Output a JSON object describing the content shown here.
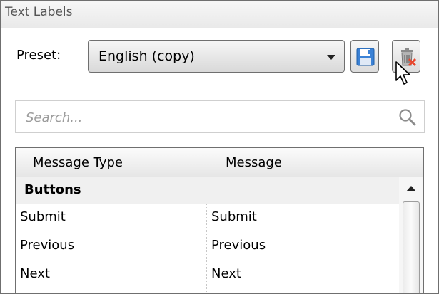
{
  "panel": {
    "title": "Text Labels"
  },
  "preset": {
    "label": "Preset:",
    "selected": "English (copy)"
  },
  "search": {
    "placeholder": "Search..."
  },
  "table": {
    "columns": [
      "Message Type",
      "Message"
    ],
    "group": "Buttons",
    "rows": [
      {
        "type": "Submit",
        "message": "Submit"
      },
      {
        "type": "Previous",
        "message": "Previous"
      },
      {
        "type": "Next",
        "message": "Next"
      }
    ]
  },
  "icons": {
    "save": "floppy-disk-icon",
    "delete": "trash-delete-icon",
    "search": "magnifier-icon"
  },
  "colors": {
    "save_blue": "#3b82d6",
    "delete_red": "#e8472e",
    "border": "#6f6f6f"
  }
}
